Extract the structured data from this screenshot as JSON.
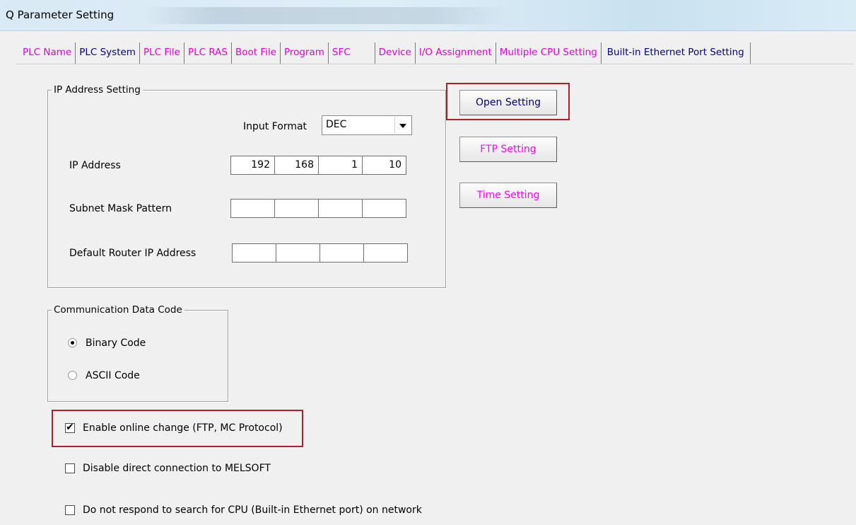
{
  "window": {
    "title": "Q Parameter Setting"
  },
  "tabs": [
    {
      "label": "PLC Name"
    },
    {
      "label": "PLC System"
    },
    {
      "label": "PLC File"
    },
    {
      "label": "PLC RAS"
    },
    {
      "label": "Boot File"
    },
    {
      "label": "Program"
    },
    {
      "label": "SFC"
    },
    {
      "label": "Device"
    },
    {
      "label": "I/O Assignment"
    },
    {
      "label": "Multiple CPU Setting"
    },
    {
      "label": "Built-in Ethernet Port Setting"
    }
  ],
  "ip_group": {
    "legend": "IP Address Setting",
    "input_format_label": "Input Format",
    "input_format_value": "DEC",
    "ip_address_label": "IP Address",
    "ip_address": [
      "192",
      "168",
      "1",
      "10"
    ],
    "subnet_label": "Subnet Mask Pattern",
    "subnet": [
      "",
      "",
      "",
      ""
    ],
    "router_label": "Default Router IP Address",
    "router": [
      "",
      "",
      "",
      ""
    ]
  },
  "buttons": {
    "open_setting": "Open Setting",
    "ftp_setting": "FTP Setting",
    "time_setting": "Time Setting"
  },
  "comm_group": {
    "legend": "Communication Data Code",
    "binary_label": "Binary Code",
    "ascii_label": "ASCII Code",
    "selected": "Binary Code"
  },
  "options": {
    "enable_online_change": {
      "label": "Enable online change (FTP, MC Protocol)",
      "checked": true
    },
    "disable_direct_connection": {
      "label": "Disable direct connection to MELSOFT",
      "checked": false
    },
    "do_not_respond": {
      "label": "Do not respond to search for CPU (Built-in Ethernet port) on network",
      "checked": false
    }
  },
  "colors": {
    "highlight_border": "#b0202a",
    "tab_link_text": "#e000d0",
    "setting_text": "#ff00ff",
    "active_text": "#000080"
  }
}
